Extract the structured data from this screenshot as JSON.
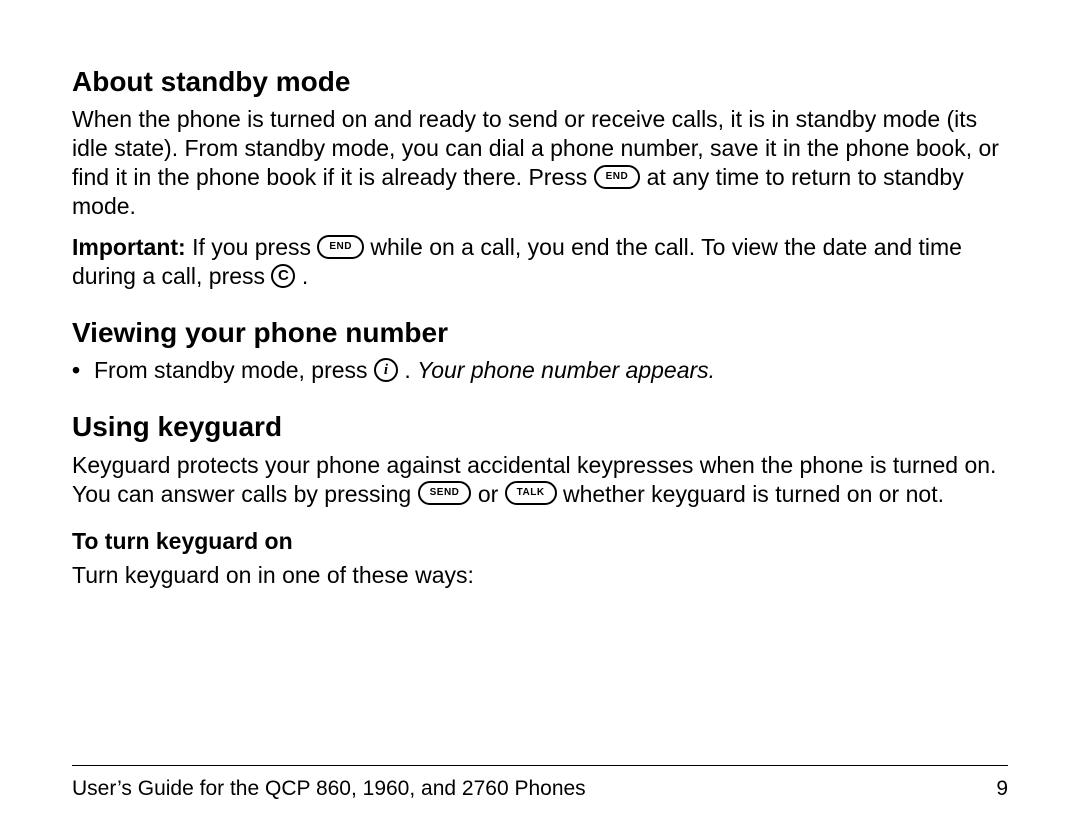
{
  "sections": {
    "s1": {
      "heading": "About standby mode",
      "p1a": "When the phone is turned on and ready to send or receive calls, it is in standby mode (its idle state). From standby mode, you can dial a phone number, save it in the phone book, or find it in the phone book if it is already there. Press ",
      "p1b": " at any time to return to standby mode.",
      "important_label": "Important:",
      "p2a": " If you press ",
      "p2b": " while on a call, you end the call. To view the date and time during a call, press ",
      "p2c": " ."
    },
    "s2": {
      "heading": "Viewing your phone number",
      "li_a": "From standby mode, press ",
      "li_b": " . ",
      "li_italic": "Your phone number appears."
    },
    "s3": {
      "heading": "Using keyguard",
      "p1a": "Keyguard protects your phone against accidental keypresses when the phone is turned on. You can answer calls by pressing ",
      "p1b": " or ",
      "p1c": " whether keyguard is turned on or not.",
      "sub_heading": "To turn keyguard on",
      "p2": "Turn keyguard on in one of these ways:"
    }
  },
  "keys": {
    "end": "END",
    "c": "C",
    "i": "i",
    "send": "SEND",
    "talk": "TALK"
  },
  "footer": {
    "left": "User’s Guide for the QCP 860, 1960, and 2760 Phones",
    "right": "9"
  }
}
